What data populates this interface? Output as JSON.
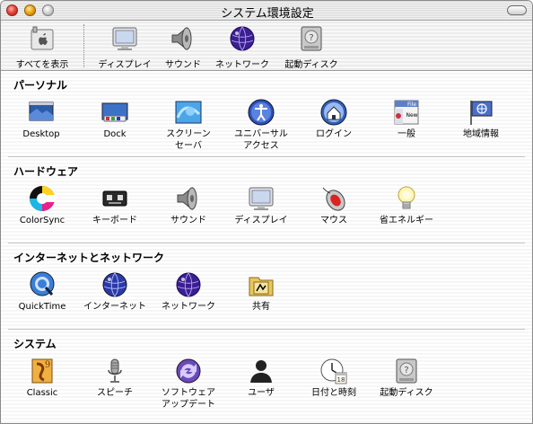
{
  "window": {
    "title": "システム環境設定"
  },
  "toolbar": {
    "show_all": {
      "label": "すべてを表示",
      "icon": "apple-switch-icon"
    },
    "items": [
      {
        "label": "ディスプレイ",
        "icon": "display-icon"
      },
      {
        "label": "サウンド",
        "icon": "speaker-icon"
      },
      {
        "label": "ネットワーク",
        "icon": "network-globe-icon"
      },
      {
        "label": "起動ディスク",
        "icon": "hard-disk-icon"
      }
    ]
  },
  "sections": {
    "personal": {
      "title": "パーソナル",
      "items": [
        {
          "label": "Desktop",
          "icon": "desktop-icon"
        },
        {
          "label": "Dock",
          "icon": "dock-icon"
        },
        {
          "label": "スクリーン\nセーバ",
          "icon": "screensaver-icon"
        },
        {
          "label": "ユニバーサル\nアクセス",
          "icon": "universal-access-icon"
        },
        {
          "label": "ログイン",
          "icon": "login-house-icon"
        },
        {
          "label": "一般",
          "icon": "general-file-icon",
          "badge_file": "File",
          "badge_new": "New"
        },
        {
          "label": "地域情報",
          "icon": "international-flag-icon"
        }
      ]
    },
    "hardware": {
      "title": "ハードウェア",
      "items": [
        {
          "label": "ColorSync",
          "icon": "colorsync-icon"
        },
        {
          "label": "キーボード",
          "icon": "keyboard-icon"
        },
        {
          "label": "サウンド",
          "icon": "speaker-icon"
        },
        {
          "label": "ディスプレイ",
          "icon": "display-icon"
        },
        {
          "label": "マウス",
          "icon": "mouse-icon"
        },
        {
          "label": "省エネルギー",
          "icon": "energy-bulb-icon"
        }
      ]
    },
    "internet": {
      "title": "インターネットとネットワーク",
      "items": [
        {
          "label": "QuickTime",
          "icon": "quicktime-icon"
        },
        {
          "label": "インターネット",
          "icon": "internet-globe-icon"
        },
        {
          "label": "ネットワーク",
          "icon": "network-globe-icon"
        },
        {
          "label": "共有",
          "icon": "sharing-folder-icon"
        }
      ]
    },
    "system": {
      "title": "システム",
      "items": [
        {
          "label": "Classic",
          "icon": "classic-icon"
        },
        {
          "label": "スピーチ",
          "icon": "microphone-icon"
        },
        {
          "label": "ソフトウェア\nアップデート",
          "icon": "software-update-icon"
        },
        {
          "label": "ユーザ",
          "icon": "user-silhouette-icon"
        },
        {
          "label": "日付と時刻",
          "icon": "clock-calendar-icon",
          "calendar_day": "18"
        },
        {
          "label": "起動ディスク",
          "icon": "hard-disk-icon"
        }
      ]
    }
  }
}
